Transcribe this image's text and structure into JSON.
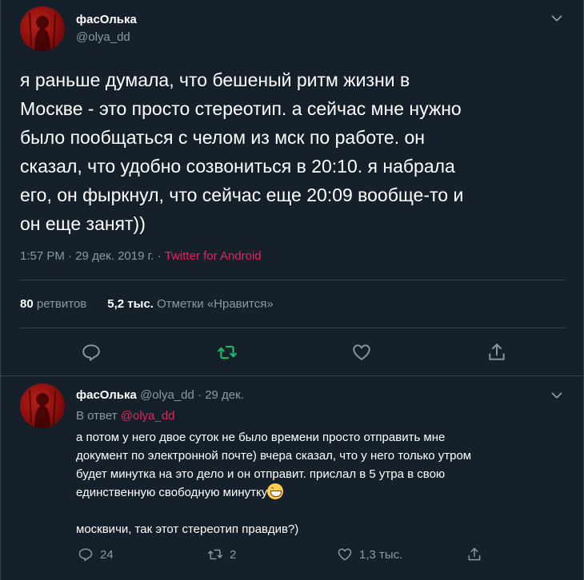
{
  "main_tweet": {
    "author_name": "фасОлька",
    "author_handle": "@olya_dd",
    "text": "я раньше думала, что бешеный ритм жизни в\nМоскве - это просто стереотип. а сейчас мне нужно\nбыло пообщаться с челом из мск по работе. он\nсказал, что удобно созвониться в 20:10. я набрала\nего, он фыркнул, что сейчас еще 20:09 вообще-то и\nон еще занят))",
    "time": "1:57 PM",
    "date": "29 дек. 2019 г.",
    "separator": "·",
    "source": "Twitter for Android",
    "retweet_count": "80",
    "retweet_label": "ретвитов",
    "like_count": "5,2 тыс.",
    "like_label": "Отметки «Нравится»"
  },
  "reply_tweet": {
    "author_name": "фасОлька",
    "author_handle": "@olya_dd",
    "separator": "·",
    "date": "29 дек.",
    "replying_to_label": "В ответ",
    "replying_to_mention": "@olya_dd",
    "text_part1": "а потом у него двое суток не было времени просто отправить мне\nдокумент по электронной почте) вчера сказал, что у него только утром\nбудет минутка на это дело и он отправит. прислал в 5 утра в свою\nединственную свободную минутку",
    "text_part2": "\n\nмосквичи, так этот стереотип правдив?)",
    "reply_count": "24",
    "retweet_count": "2",
    "like_count": "1,3 тыс."
  },
  "icons": {
    "reply": "reply-bubble-icon",
    "retweet": "retweet-icon",
    "like": "heart-icon",
    "share": "share-icon",
    "more": "chevron-down-icon",
    "emoji": "grinning-face-emoji"
  },
  "colors": {
    "background": "#15202b",
    "border": "#38444d",
    "secondary_text": "#8899a6",
    "accent_pink": "#e0245e",
    "retweet_green": "#17bf63"
  }
}
